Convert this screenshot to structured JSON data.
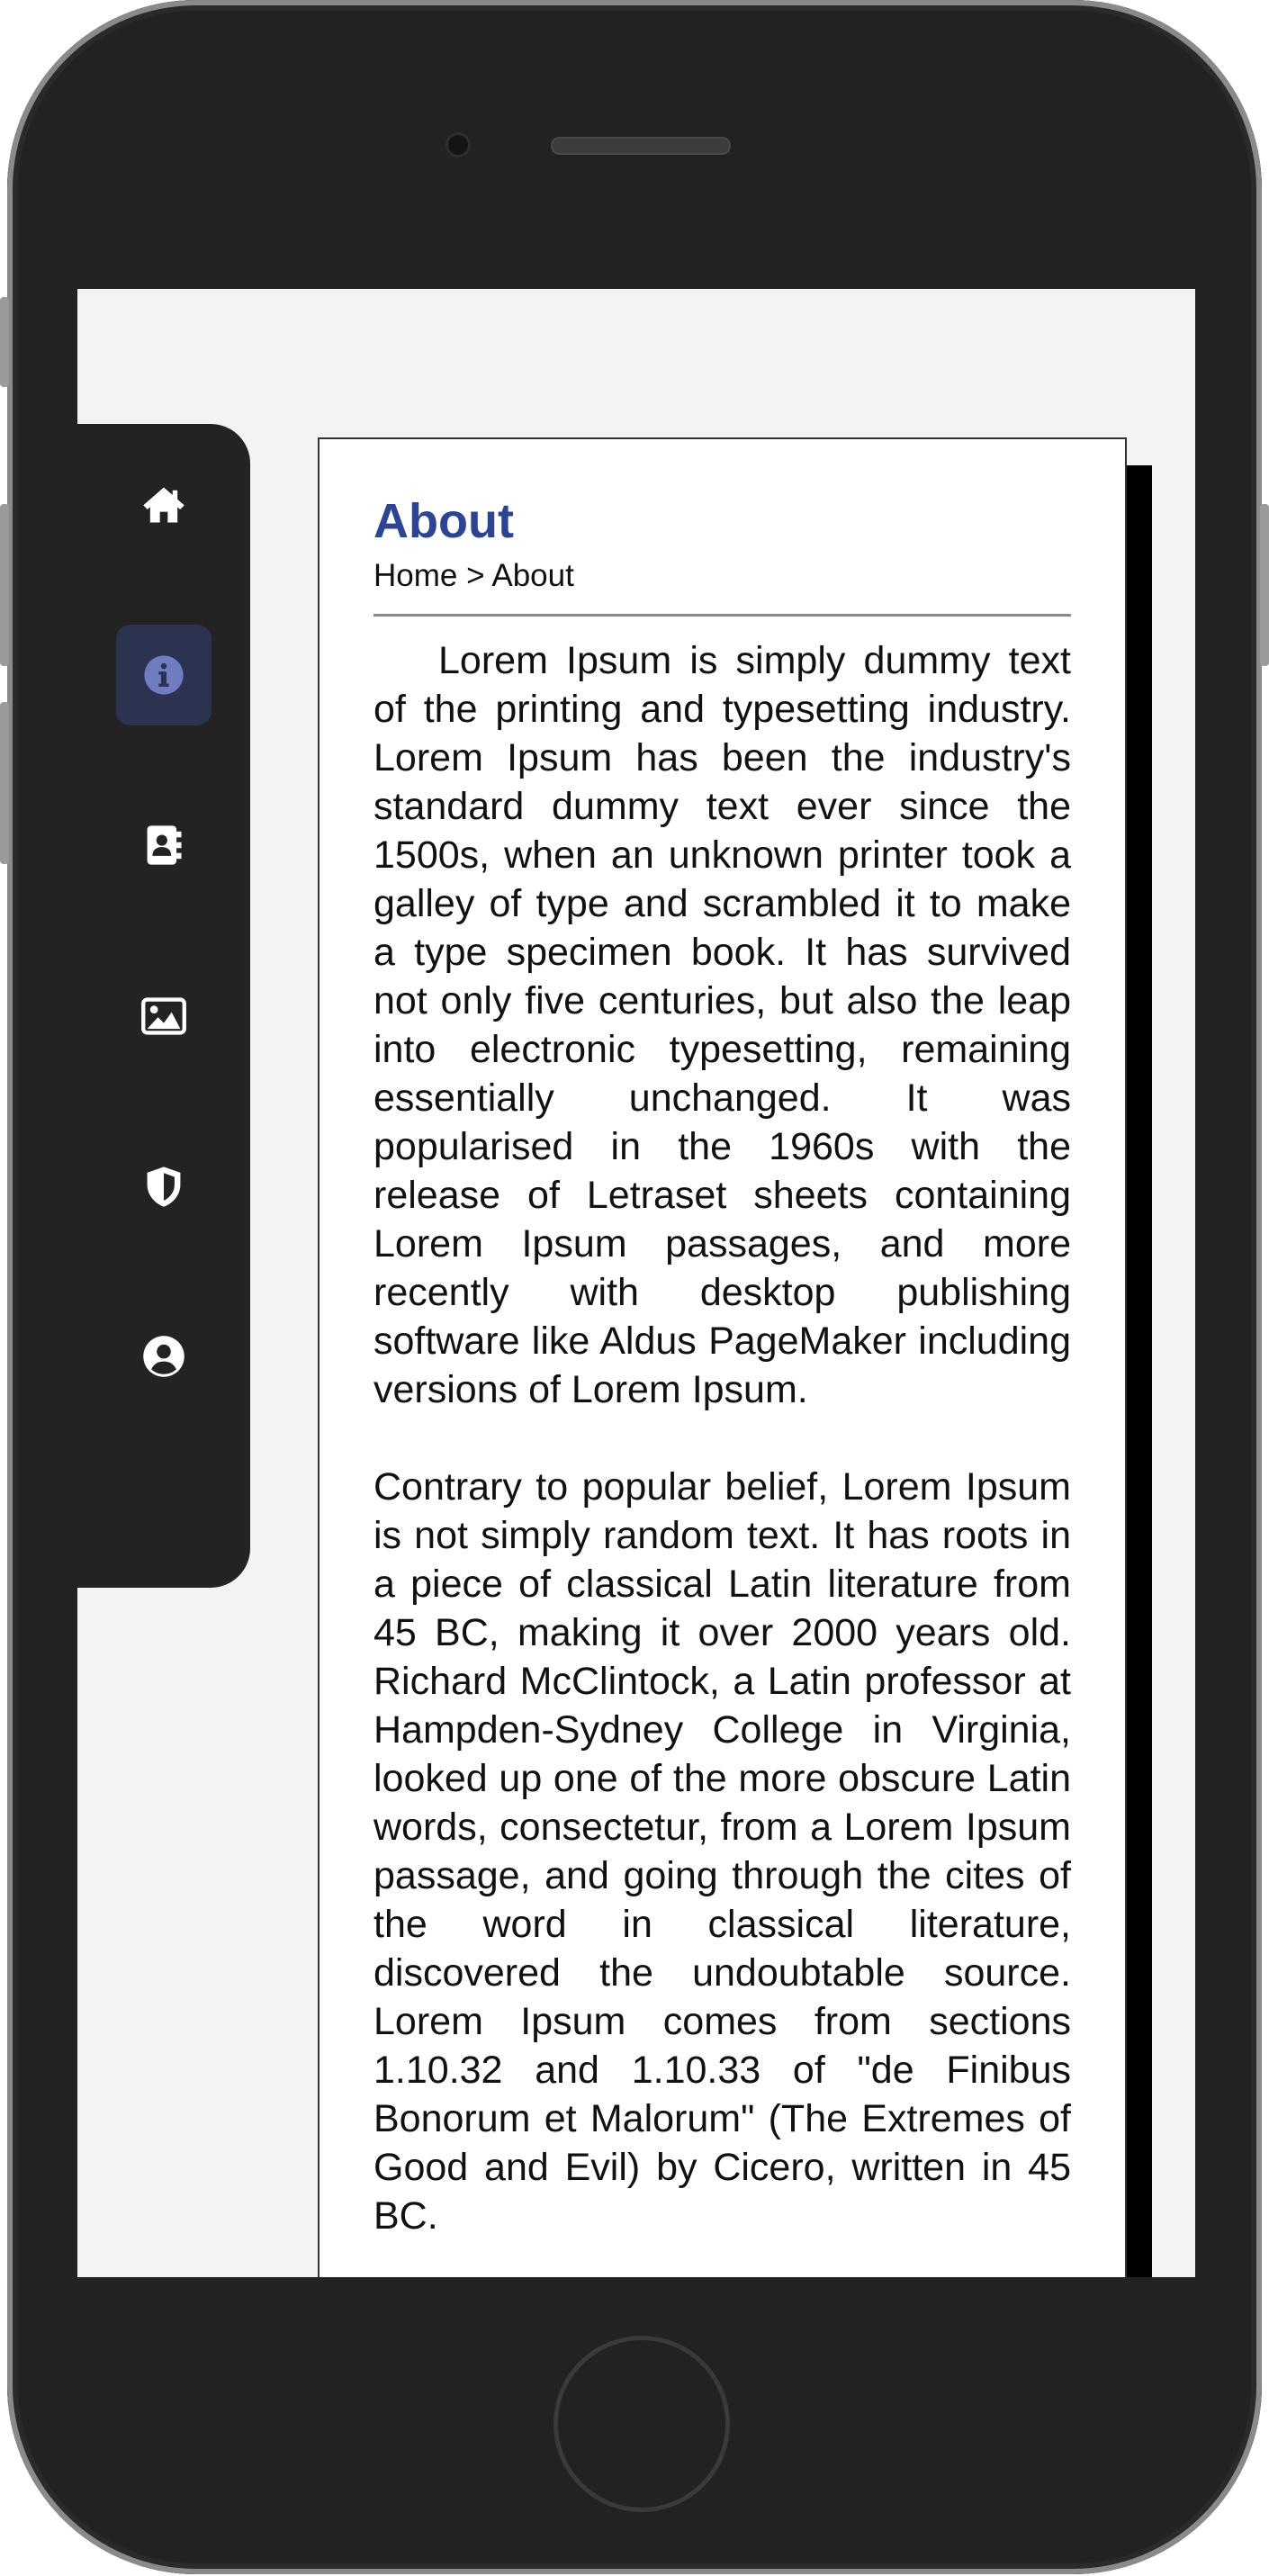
{
  "nav": {
    "items": [
      {
        "icon": "home-icon",
        "label": "Home",
        "active": false
      },
      {
        "icon": "info-icon",
        "label": "About",
        "active": true
      },
      {
        "icon": "contact-book-icon",
        "label": "Contacts",
        "active": false
      },
      {
        "icon": "image-icon",
        "label": "Gallery",
        "active": false
      },
      {
        "icon": "shield-icon",
        "label": "Security",
        "active": false
      },
      {
        "icon": "user-icon",
        "label": "Profile",
        "active": false
      }
    ]
  },
  "page": {
    "title": "About",
    "breadcrumb": {
      "home": "Home",
      "separator": ">",
      "current": "About"
    },
    "paragraphs": [
      "Lorem Ipsum is simply dummy text of the printing and typesetting industry. Lorem Ipsum has been the industry's standard dummy text ever since the 1500s, when an unknown printer took a galley of type and scrambled it to make a type specimen book. It has survived not only five centuries, but also the leap into electronic typesetting, remaining essentially unchanged. It was popularised in the 1960s with the release of Letraset sheets containing Lorem Ipsum passages, and more recently with desktop publishing software like Aldus PageMaker including versions of Lorem Ipsum.",
      "Contrary to popular belief, Lorem Ipsum is not simply random text. It has roots in a piece of classical Latin literature from 45 BC, making it over 2000 years old. Richard McClintock, a Latin professor at Hampden-Sydney College in Virginia, looked up one of the more obscure Latin words, consectetur, from a Lorem Ipsum passage, and going through the cites of the word in classical literature, discovered the undoubtable source. Lorem Ipsum comes from sections 1.10.32 and 1.10.33 of \"de Finibus Bonorum et Malorum\" (The Extremes of Good and Evil) by Cicero, written in 45 BC."
    ]
  },
  "colors": {
    "accent": "#2c4496",
    "sidebar_bg": "#232323",
    "active_nav_bg": "#2c3350",
    "active_icon": "#6f7cc0",
    "screen_bg": "#f3f3f3"
  }
}
